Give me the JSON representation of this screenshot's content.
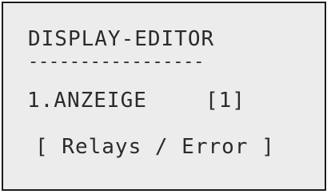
{
  "display": {
    "title": "DISPLAY-EDITOR",
    "rule": "-----------------",
    "item_label": "1.ANZEIGE",
    "item_value": "[1]",
    "submenu_value": "[ Relays / Error ]"
  }
}
